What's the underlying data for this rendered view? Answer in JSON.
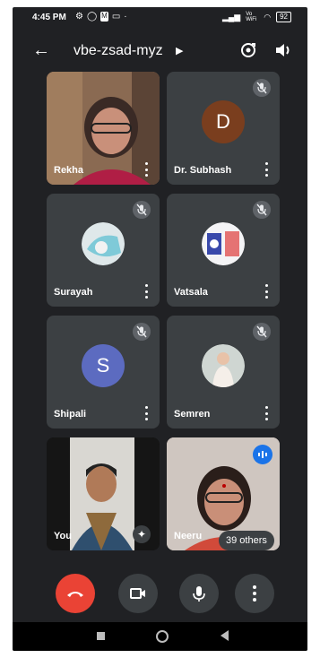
{
  "status_bar": {
    "time": "4:45 PM",
    "network": "Vo WiFi",
    "battery": "92"
  },
  "header": {
    "title": "vbe-zsad-myz"
  },
  "participants": [
    {
      "name": "Rekha",
      "muted": false,
      "kind": "video"
    },
    {
      "name": "Dr. Subhash",
      "muted": true,
      "kind": "initial",
      "initial": "D",
      "color": "#7a3e1e"
    },
    {
      "name": "Surayah",
      "muted": true,
      "kind": "photo"
    },
    {
      "name": "Vatsala",
      "muted": true,
      "kind": "photo"
    },
    {
      "name": "Shipali",
      "muted": true,
      "kind": "initial",
      "initial": "S",
      "color": "#5c6bc0"
    },
    {
      "name": "Semren",
      "muted": true,
      "kind": "photo"
    },
    {
      "name": "You",
      "muted": false,
      "kind": "video"
    },
    {
      "name": "Neeru",
      "muted": false,
      "kind": "video",
      "speaking": true
    }
  ],
  "others_badge": "39 others",
  "colors": {
    "background": "#202124",
    "tile": "#3c4043",
    "end_call": "#ea4335",
    "speaking_indicator": "#1a73e8"
  }
}
